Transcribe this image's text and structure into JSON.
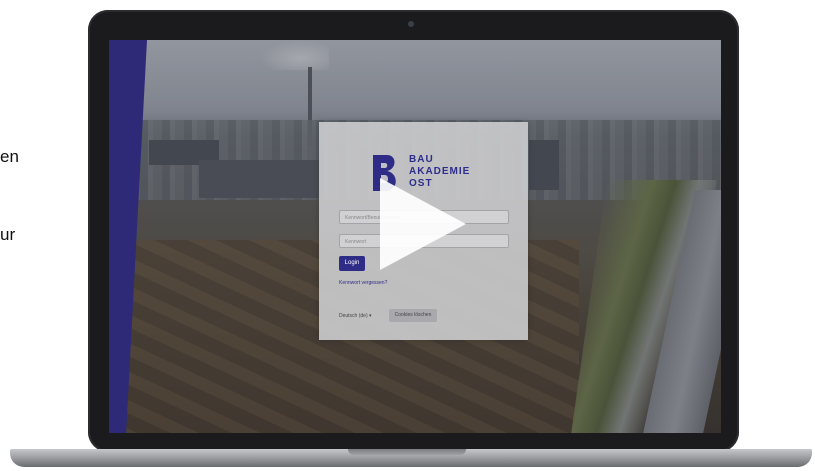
{
  "background_text": {
    "line1": "en",
    "line2": "ur"
  },
  "login_page": {
    "brand": {
      "line1": "BAU",
      "line2": "AKADEMIE",
      "line3": "OST"
    },
    "username_placeholder": "Kennwort/Benutzername",
    "password_placeholder": "Kennwort",
    "login_label": "Login",
    "forgot_password_label": "Kennwort vergessen?",
    "language_label": "Deutsch (de) ▾",
    "cookie_label": "Cookies löschen"
  },
  "colors": {
    "brand": "#2e2c86",
    "side_band": "#2e2a78"
  },
  "icons": {
    "play": "play-icon",
    "logo": "bau-logo-icon"
  }
}
